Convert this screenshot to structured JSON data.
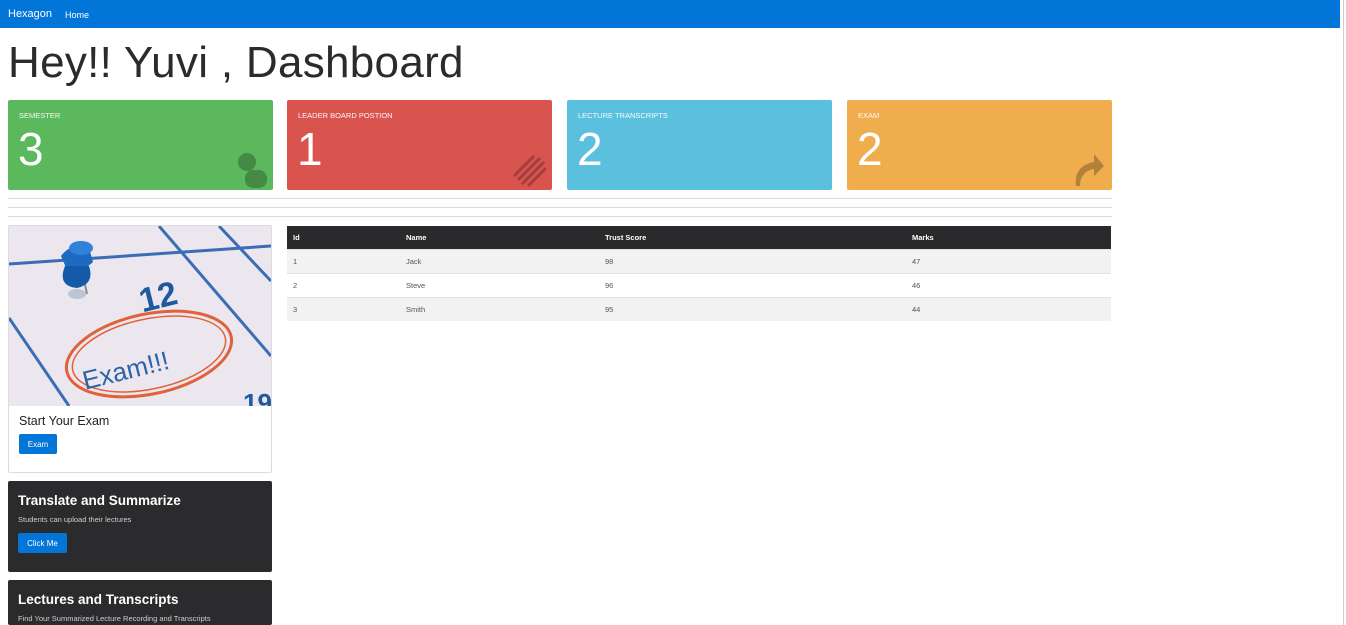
{
  "navbar": {
    "brand": "Hexagon",
    "home": "Home"
  },
  "page": {
    "title": "Hey!! Yuvi , Dashboard"
  },
  "stats": [
    {
      "label": "SEMESTER",
      "value": "3",
      "color": "#5cb85c",
      "icon": "user-icon"
    },
    {
      "label": "LEADER BOARD POSTION",
      "value": "1",
      "color": "#d9534f",
      "icon": "striped-bar-icon"
    },
    {
      "label": "LECTURE TRANSCRIPTS",
      "value": "2",
      "color": "#5bc0de",
      "icon": "transcript-icon"
    },
    {
      "label": "EXAM",
      "value": "2",
      "color": "#f0ad4e",
      "icon": "share-arrow-icon"
    }
  ],
  "exam_card": {
    "image_text": {
      "date": "12",
      "word": "Exam!!!",
      "partial_date": "19"
    },
    "title": "Start Your Exam",
    "button": "Exam"
  },
  "translate_card": {
    "title": "Translate and Summarize",
    "subtitle": "Students can upload their lectures",
    "button": "Click Me"
  },
  "lectures_card": {
    "title": "Lectures and Transcripts",
    "subtitle": "Find Your Summarized Lecture Recording and Transcripts"
  },
  "leaderboard": {
    "headers": [
      "Id",
      "Name",
      "Trust Score",
      "Marks"
    ],
    "rows": [
      [
        "1",
        "Jack",
        "98",
        "47"
      ],
      [
        "2",
        "Steve",
        "96",
        "46"
      ],
      [
        "3",
        "Smith",
        "95",
        "44"
      ]
    ]
  },
  "colors": {
    "primary": "#0275d8",
    "dark_card": "#2b2b2d",
    "table_header": "#2a2a2c"
  }
}
